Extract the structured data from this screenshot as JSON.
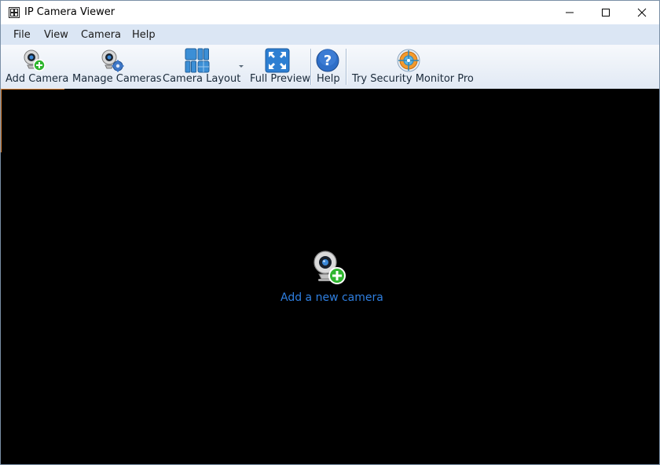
{
  "window": {
    "title": "IP Camera Viewer",
    "icon": "app-grid-icon",
    "controls": {
      "minimize": "minimize-icon",
      "maximize": "maximize-icon",
      "close": "close-icon"
    }
  },
  "menu": {
    "file": "File",
    "view": "View",
    "camera": "Camera",
    "help": "Help"
  },
  "toolbar": {
    "add_camera": "Add Camera",
    "manage_cameras": "Manage Cameras",
    "camera_layout": "Camera Layout",
    "full_preview": "Full Preview",
    "help": "Help",
    "try_pro": "Try Security Monitor Pro"
  },
  "content": {
    "add_camera_link": "Add a new camera"
  },
  "colors": {
    "content_bg": "#000000",
    "link": "#2f7fe0",
    "menubar": "#dbe6f4"
  }
}
